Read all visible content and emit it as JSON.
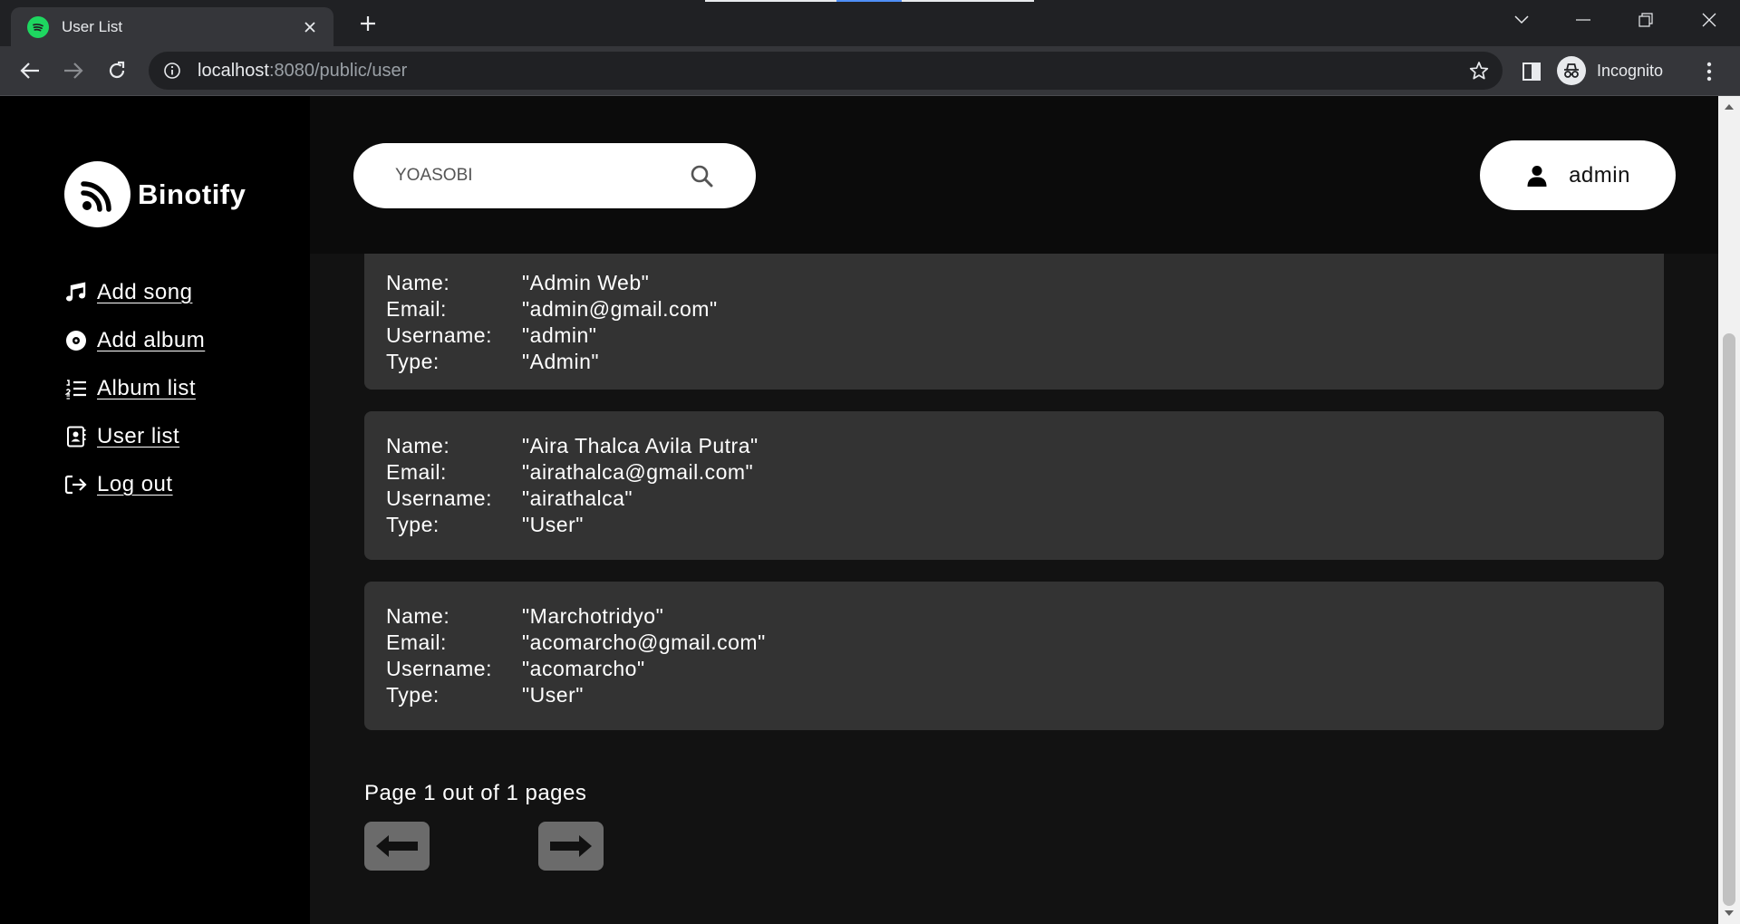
{
  "browser": {
    "tab_title": "User List",
    "url_host": "localhost",
    "url_rest": ":8080/public/user",
    "profile_label": "Incognito"
  },
  "app": {
    "brand": "Binotify",
    "nav": [
      {
        "label": "Add song",
        "icon": "music-note-icon"
      },
      {
        "label": "Add album",
        "icon": "disc-icon"
      },
      {
        "label": "Album list",
        "icon": "numbered-list-icon"
      },
      {
        "label": "User list",
        "icon": "contact-card-icon"
      },
      {
        "label": "Log out",
        "icon": "logout-icon"
      }
    ],
    "search": {
      "placeholder": "YOASOBI"
    },
    "user_button": "admin",
    "field_labels": {
      "name": "Name:",
      "email": "Email:",
      "username": "Username:",
      "type": "Type:"
    },
    "users": [
      {
        "name": "\"Admin Web\"",
        "email": "\"admin@gmail.com\"",
        "username": "\"admin\"",
        "type": "\"Admin\""
      },
      {
        "name": "\"Aira Thalca Avila Putra\"",
        "email": "\"airathalca@gmail.com\"",
        "username": "\"airathalca\"",
        "type": "\"User\""
      },
      {
        "name": "\"Marchotridyo\"",
        "email": "\"acomarcho@gmail.com\"",
        "username": "\"acomarcho\"",
        "type": "\"User\""
      }
    ],
    "pagination": "Page 1 out of 1 pages"
  },
  "colors": {
    "spotify_green": "#1ed760",
    "sidebar_bg": "#000000",
    "card_bg": "#333333",
    "button_gray": "#6b6b6b"
  }
}
